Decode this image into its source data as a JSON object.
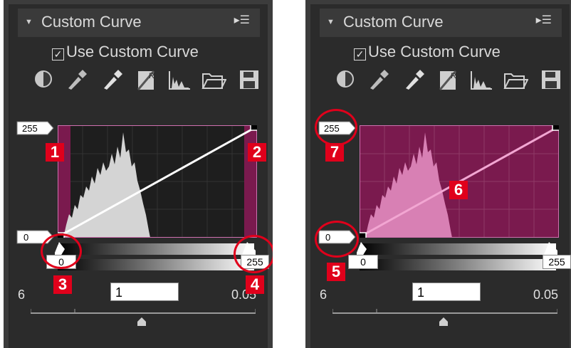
{
  "panel_left": {
    "title": "Custom Curve",
    "use_custom_curve": "Use Custom Curve",
    "output_high": "255",
    "output_low": "0",
    "input_low": "0",
    "input_high": "255",
    "gamma": "1",
    "range_min": "6",
    "range_max": "0.05",
    "markers": [
      "1",
      "2",
      "3",
      "4"
    ]
  },
  "panel_right": {
    "title": "Custom Curve",
    "use_custom_curve": "Use Custom Curve",
    "output_high": "255",
    "output_low": "0",
    "input_low": "0",
    "input_high": "255",
    "gamma": "1",
    "range_min": "6",
    "range_max": "0.05",
    "markers": [
      "5",
      "6",
      "7"
    ]
  },
  "icons": [
    "contrast-icon",
    "eyedropper-black-icon",
    "eyedropper-white-icon",
    "reset-channel-icon",
    "histogram-icon",
    "open-folder-icon",
    "save-icon"
  ],
  "colors": {
    "accent": "#e0001b",
    "highlight": "#7a1a4e",
    "panel": "#3c3c3c"
  }
}
